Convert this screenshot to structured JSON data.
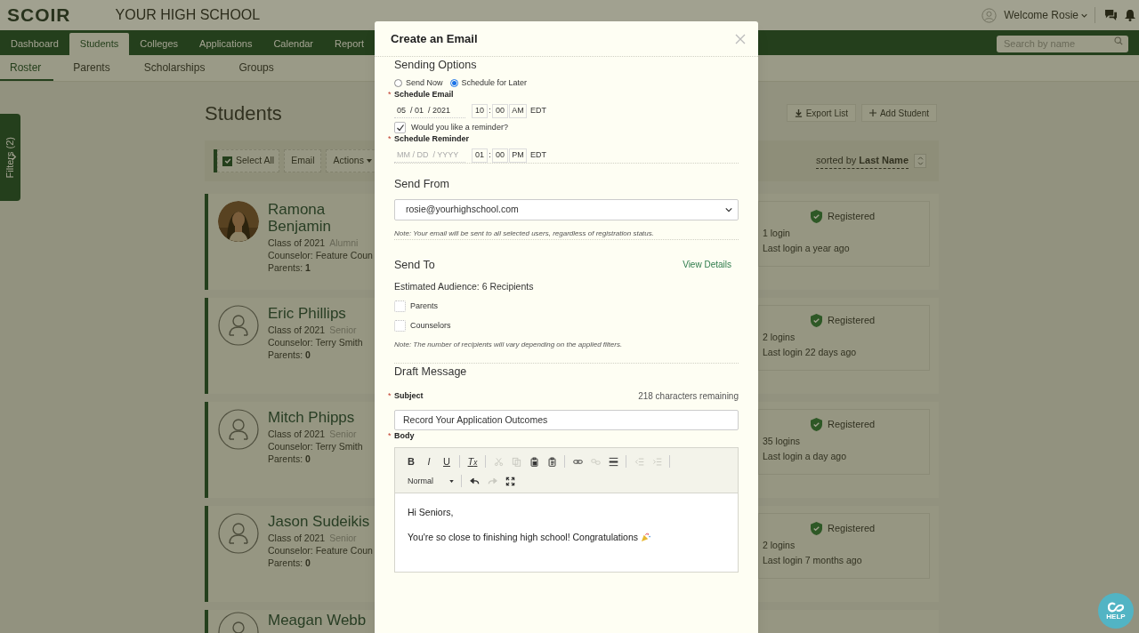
{
  "header": {
    "logo": "SCOIR",
    "school": "YOUR HIGH SCHOOL",
    "welcome": "Welcome Rosie"
  },
  "nav": {
    "tabs": [
      {
        "label": "Dashboard",
        "selected": false
      },
      {
        "label": "Students",
        "selected": true
      },
      {
        "label": "Colleges",
        "selected": false
      },
      {
        "label": "Applications",
        "selected": false
      },
      {
        "label": "Calendar",
        "selected": false
      },
      {
        "label": "Report",
        "selected": false
      }
    ],
    "search": {
      "placeholder": "Search by name"
    }
  },
  "subnav": [
    {
      "label": "Roster",
      "selected": true
    },
    {
      "label": "Parents",
      "selected": false
    },
    {
      "label": "Scholarships",
      "selected": false
    },
    {
      "label": "Groups",
      "selected": false
    }
  ],
  "filters": {
    "label": "Filters (2)"
  },
  "help": {
    "label": "HELP"
  },
  "page": {
    "title": "Students",
    "actions": [
      {
        "kind": "export",
        "label": "Export List"
      },
      {
        "kind": "add",
        "label": "Add Student"
      }
    ],
    "toolbar": {
      "select_all": {
        "label": "Select All",
        "checked": true
      },
      "buttons": [
        {
          "label": "Email",
          "dropdown": false
        },
        {
          "label": "Actions",
          "dropdown": true
        }
      ],
      "sort": "sorted by **Last Name**"
    }
  },
  "students": [
    {
      "name": "Ramona Benjamin",
      "class": "Class of 2021",
      "status": "Alumni",
      "counselor": "Counselor: Feature Coun",
      "parents": "Parents: **1**",
      "registration": "Registered",
      "logins": "1 login",
      "last_login": "Last login a year ago"
    },
    {
      "name": "Eric Phillips",
      "avatar": {
        "kind": "generic"
      },
      "class": "Class of 2021",
      "status": "Senior",
      "counselor": "Counselor: Terry Smith",
      "parents": "Parents: **0**",
      "registration": "Registered",
      "logins": "2 logins",
      "last_login": "Last login 22 days ago"
    },
    {
      "name": "Mitch Phipps",
      "avatar": {
        "kind": "generic"
      },
      "class": "Class of 2021",
      "status": "Senior",
      "counselor": "Counselor: Terry Smith",
      "parents": "Parents: **0**",
      "registration": "Registered",
      "logins": "35 logins",
      "last_login": "Last login a day ago"
    },
    {
      "name": "Jason Sudeikis",
      "avatar": {
        "kind": "generic"
      },
      "class": "Class of 2021",
      "status": "Senior",
      "counselor": "Counselor: Feature Coun",
      "parents": "Parents: **0**",
      "registration": "Registered",
      "logins": "2 logins",
      "last_login": "Last login 7 months ago"
    },
    {
      "name": "Meagan Webb",
      "avatar": {
        "kind": "generic"
      }
    }
  ],
  "dialog": {
    "title": "Create an Email",
    "sending": {
      "heading": "Sending Options",
      "options": [
        {
          "label": "Send Now",
          "selected": false
        },
        {
          "label": "Schedule for Later",
          "selected": true
        }
      ]
    },
    "schedule": {
      "mark": "*",
      "label": "Schedule Email",
      "date": "05  / 01  / 2021",
      "hour": "10",
      "separator": ":",
      "minute": "00",
      "period": "AM",
      "zone": "EDT"
    },
    "reminder": {
      "label": "Would you like a reminder?",
      "checked": true
    },
    "reminder_schedule": {
      "mark": "*",
      "label": "Schedule Reminder",
      "date_placeholder": "MM / DD  / YYYY",
      "hour": "01",
      "separator": ":",
      "minute": "00",
      "period": "PM",
      "zone": "EDT"
    },
    "send_from": {
      "heading": "Send From",
      "value": "rosie@yourhighschool.com",
      "note": "Note: Your email will be sent to all selected users, regardless of registration status."
    },
    "send_to": {
      "heading": "Send To",
      "link": "View Details",
      "audience": "Estimated Audience: 6 Recipients",
      "options": [
        {
          "label": "Parents",
          "checked": false
        },
        {
          "label": "Counselors",
          "checked": false
        }
      ],
      "note": "Note: The number of recipients will vary depending on the applied filters."
    },
    "draft": {
      "heading": "Draft Message",
      "subject": {
        "mark": "*",
        "label": "Subject",
        "counter": "218 characters remaining",
        "value": "Record Your Application Outcomes"
      },
      "body": {
        "mark": "*",
        "label": "Body",
        "tools": [
          {
            "kind": "bold",
            "label": "B",
            "disabled": false
          },
          {
            "kind": "italic",
            "label": "I",
            "disabled": false
          },
          {
            "kind": "underline",
            "label": "U",
            "disabled": false
          },
          {
            "kind": "sep"
          },
          {
            "kind": "clear",
            "label": "T$_{x}$",
            "disabled": false
          },
          {
            "kind": "sep"
          },
          {
            "kind": "cut",
            "disabled": true
          },
          {
            "kind": "copy",
            "disabled": true
          },
          {
            "kind": "paste",
            "disabled": false
          },
          {
            "kind": "paste-text",
            "disabled": false
          },
          {
            "kind": "sep"
          },
          {
            "kind": "link",
            "disabled": false
          },
          {
            "kind": "unlink",
            "disabled": true
          },
          {
            "kind": "rule",
            "disabled": false
          },
          {
            "kind": "sep"
          },
          {
            "kind": "outdent",
            "disabled": true
          },
          {
            "kind": "indent",
            "disabled": true
          },
          {
            "kind": "sep"
          }
        ],
        "tools2": [
          {
            "kind": "format",
            "label": "Normal"
          },
          {
            "kind": "sep"
          },
          {
            "kind": "undo",
            "disabled": false
          },
          {
            "kind": "redo",
            "disabled": true
          },
          {
            "kind": "maximize",
            "disabled": false
          }
        ],
        "paragraphs": [
          {
            "text": "Hi Seniors,",
            "celebration": false
          },
          {
            "text": "You're so close to finishing high school! Congratulations",
            "celebration": true
          }
        ]
      }
    }
  }
}
